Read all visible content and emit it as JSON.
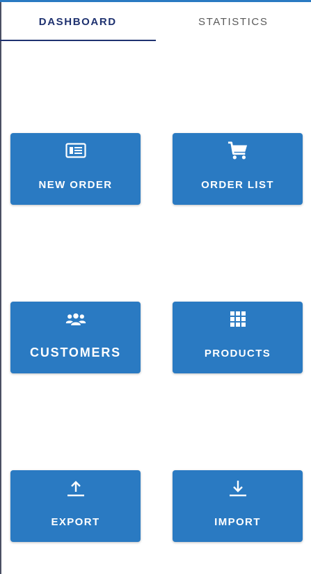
{
  "tabs": [
    {
      "label": "DASHBOARD",
      "active": true
    },
    {
      "label": "STATISTICS",
      "active": false
    }
  ],
  "tiles": {
    "new_order": {
      "label": "NEW ORDER",
      "icon": "newspaper-icon"
    },
    "order_list": {
      "label": "ORDER LIST",
      "icon": "cart-icon"
    },
    "customers": {
      "label": "CUSTOMERS",
      "icon": "people-group-icon"
    },
    "products": {
      "label": "PRODUCTS",
      "icon": "grid-icon"
    },
    "export": {
      "label": "EXPORT",
      "icon": "upload-icon"
    },
    "import": {
      "label": "IMPORT",
      "icon": "download-icon"
    }
  },
  "colors": {
    "tile_bg": "#2a7ac2",
    "active_tab": "#1f3270",
    "inactive_tab": "#5a5a5a",
    "tile_text": "#ffffff"
  }
}
